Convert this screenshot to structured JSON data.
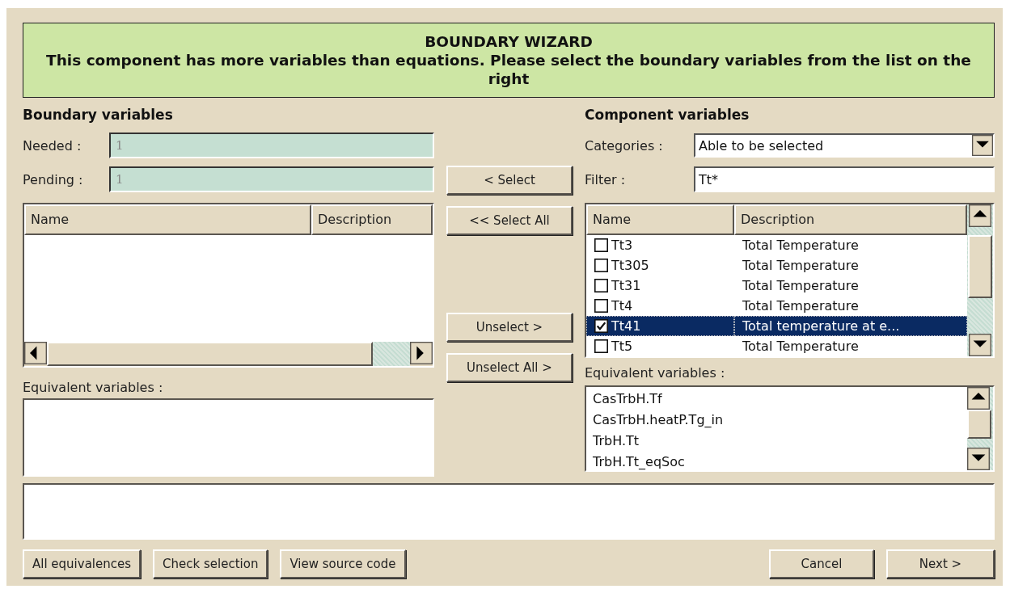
{
  "header": {
    "title": "BOUNDARY WIZARD",
    "message": "This component has more variables than equations. Please select the boundary variables from the list on the right"
  },
  "boundary": {
    "heading": "Boundary variables",
    "fields": [
      {
        "label": "Needed :",
        "value": "1"
      },
      {
        "label": "Pending :",
        "value": "1"
      }
    ],
    "columns": [
      "Name",
      "Description"
    ],
    "equivalent_label": "Equivalent variables :"
  },
  "transfer_buttons": [
    "< Select",
    "<< Select All",
    "Unselect >",
    "Unselect All >"
  ],
  "component": {
    "heading": "Component variables",
    "categories": {
      "label": "Categories :",
      "value": "Able to be selected"
    },
    "filter": {
      "label": "Filter :",
      "value": "Tt*"
    },
    "columns": [
      "Name",
      "Description"
    ],
    "rows": [
      {
        "name": "Tt3",
        "description": "Total Temperature",
        "checked": false,
        "selected": false
      },
      {
        "name": "Tt305",
        "description": "Total Temperature",
        "checked": false,
        "selected": false
      },
      {
        "name": "Tt31",
        "description": "Total Temperature",
        "checked": false,
        "selected": false
      },
      {
        "name": "Tt4",
        "description": "Total Temperature",
        "checked": false,
        "selected": false
      },
      {
        "name": "Tt41",
        "description": "Total temperature at e...",
        "checked": true,
        "selected": true
      },
      {
        "name": "Tt5",
        "description": "Total Temperature",
        "checked": false,
        "selected": false
      }
    ],
    "equivalent_label": "Equivalent variables :",
    "equivalents": [
      "CasTrbH.Tf",
      "CasTrbH.heatP.Tg_in",
      "TrbH.Tt",
      "TrbH.Tt_eqSoc"
    ]
  },
  "tool_buttons": [
    "All equivalences",
    "Check selection",
    "View source code"
  ],
  "dialog_buttons": [
    "Cancel",
    "Next >"
  ]
}
